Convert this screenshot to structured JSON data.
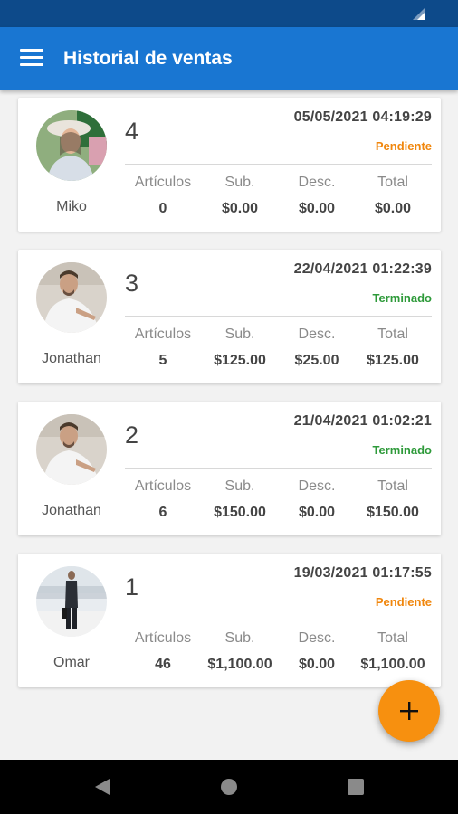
{
  "app": {
    "title": "Historial de ventas"
  },
  "labels": {
    "items": "Artículos",
    "subtotal": "Sub.",
    "discount": "Desc.",
    "total": "Total"
  },
  "colors": {
    "primary": "#1976d2",
    "status_bar": "#0d4a8a",
    "pending": "#f0860c",
    "done": "#2e9a3a",
    "fab": "#f7900f"
  },
  "sales": [
    {
      "number": "4",
      "customer": "Miko",
      "date": "05/05/2021 04:19:29",
      "status": "Pendiente",
      "items": "0",
      "subtotal": "$0.00",
      "discount": "$0.00",
      "total": "$0.00"
    },
    {
      "number": "3",
      "customer": "Jonathan",
      "date": "22/04/2021 01:22:39",
      "status": "Terminado",
      "items": "5",
      "subtotal": "$125.00",
      "discount": "$25.00",
      "total": "$125.00"
    },
    {
      "number": "2",
      "customer": "Jonathan",
      "date": "21/04/2021 01:02:21",
      "status": "Terminado",
      "items": "6",
      "subtotal": "$150.00",
      "discount": "$0.00",
      "total": "$150.00"
    },
    {
      "number": "1",
      "customer": "Omar",
      "date": "19/03/2021 01:17:55",
      "status": "Pendiente",
      "items": "46",
      "subtotal": "$1,100.00",
      "discount": "$0.00",
      "total": "$1,100.00"
    }
  ],
  "icons": {
    "menu": "menu-icon",
    "fab": "plus-icon",
    "nav": [
      "back-icon",
      "home-icon",
      "recents-icon"
    ],
    "status": "signal-icon"
  }
}
